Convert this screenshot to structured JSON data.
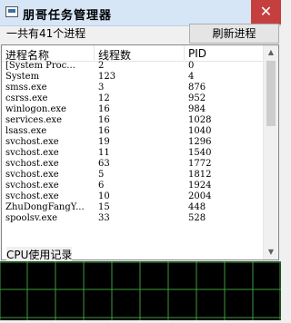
{
  "window": {
    "title": "朋哥任务管理器",
    "close_glyph": "✕"
  },
  "toolbar": {
    "summary": "一共有41个进程",
    "refresh_label": "刷新进程"
  },
  "table": {
    "columns": [
      "进程名称",
      "线程数",
      "PID"
    ],
    "rows": [
      [
        "[System Proc...",
        "2",
        "0"
      ],
      [
        "System",
        "123",
        "4"
      ],
      [
        "smss.exe",
        "3",
        "876"
      ],
      [
        "csrss.exe",
        "12",
        "952"
      ],
      [
        "winlogon.exe",
        "16",
        "984"
      ],
      [
        "services.exe",
        "16",
        "1028"
      ],
      [
        "lsass.exe",
        "16",
        "1040"
      ],
      [
        "svchost.exe",
        "19",
        "1296"
      ],
      [
        "svchost.exe",
        "11",
        "1540"
      ],
      [
        "svchost.exe",
        "63",
        "1772"
      ],
      [
        "svchost.exe",
        "5",
        "1812"
      ],
      [
        "svchost.exe",
        "6",
        "1924"
      ],
      [
        "svchost.exe",
        "10",
        "2004"
      ],
      [
        "ZhuDongFangY...",
        "15",
        "448"
      ],
      [
        "spoolsv.exe",
        "33",
        "528"
      ]
    ]
  },
  "cpu": {
    "label": "CPU使用记录"
  },
  "colors": {
    "grid": "#3c9c3c",
    "graph_bg": "#000000",
    "close_bg": "#c63f3f"
  }
}
